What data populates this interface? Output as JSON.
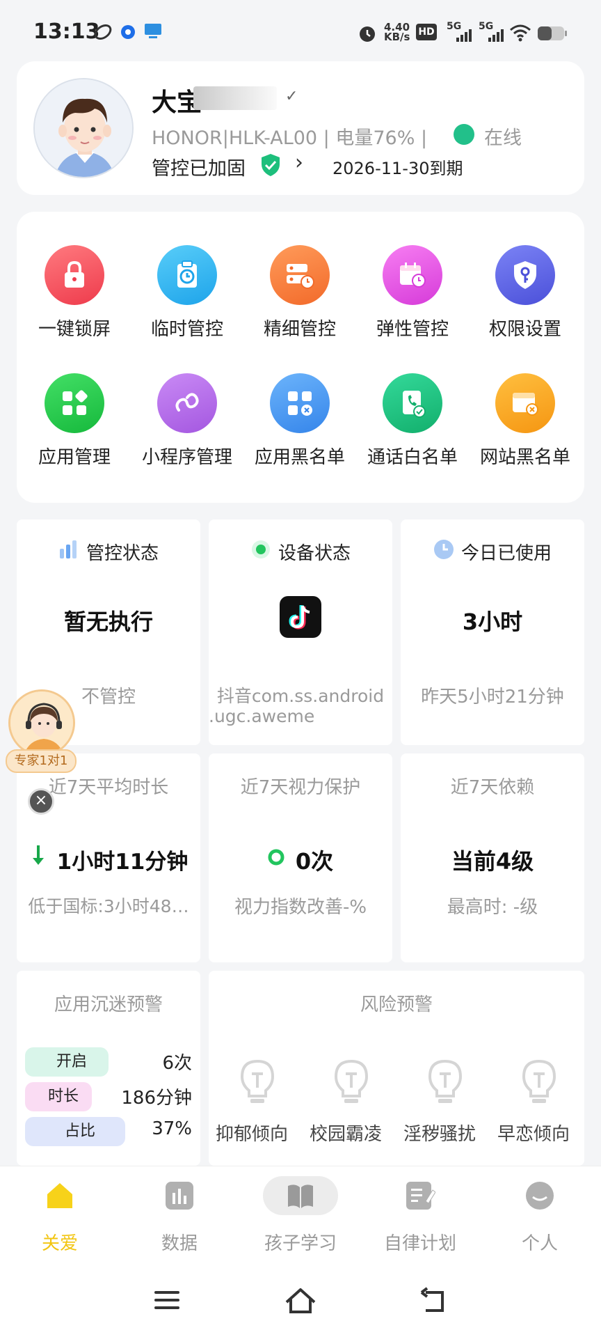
{
  "status_bar": {
    "time": "13:13",
    "net_speed_value": "4.40",
    "net_speed_unit": "KB/s",
    "hd_label": "HD",
    "signal1": "5G",
    "signal2": "5G"
  },
  "profile": {
    "name_visible": "大宝",
    "device_info": "HONOR|HLK-AL00 | 电量76% |",
    "online_status": "在线",
    "reinforce_status": "管控已加固",
    "expiry": "2026-11-30到期"
  },
  "features": [
    {
      "label": "一键锁屏",
      "icon": "lock-icon",
      "color": "#f4545e"
    },
    {
      "label": "临时管控",
      "icon": "clock-clipboard-icon",
      "color": "#2fb4f0"
    },
    {
      "label": "精细管控",
      "icon": "server-settings-icon",
      "color": "#f67a3a"
    },
    {
      "label": "弹性管控",
      "icon": "calendar-icon",
      "color": "#e24be3"
    },
    {
      "label": "权限设置",
      "icon": "key-shield-icon",
      "color": "#5a63e8"
    },
    {
      "label": "应用管理",
      "icon": "apps-icon",
      "color": "#1ec84a"
    },
    {
      "label": "小程序管理",
      "icon": "mini-program-icon",
      "color": "#b66be8"
    },
    {
      "label": "应用黑名单",
      "icon": "app-block-icon",
      "color": "#4a9af0"
    },
    {
      "label": "通话白名单",
      "icon": "phone-book-icon",
      "color": "#1dbf7c"
    },
    {
      "label": "网站黑名单",
      "icon": "web-block-icon",
      "color": "#f7a21f"
    }
  ],
  "stats": {
    "control_status": {
      "title": "管控状态",
      "value": "暂无执行",
      "sub": "不管控"
    },
    "device_status": {
      "title": "设备状态",
      "app_line1": "抖音com.ss.android",
      "app_line2": ".ugc.aweme"
    },
    "today_used": {
      "title": "今日已使用",
      "value": "3小时",
      "sub": "昨天5小时21分钟"
    },
    "avg_7d": {
      "title": "近7天平均时长",
      "value": "1小时11分钟",
      "sub": "低于国标:3小时48…"
    },
    "vision_7d": {
      "title": "近7天视力保护",
      "value": "0次",
      "sub": "视力指数改善-%"
    },
    "dependency_7d": {
      "title": "近7天依赖",
      "value": "当前4级",
      "sub": "最高时: -级"
    }
  },
  "addiction_warning": {
    "title": "应用沉迷预警",
    "rows": [
      {
        "label": "开启",
        "value": "6次",
        "color": "#d9f5ea"
      },
      {
        "label": "时长",
        "value": "186分钟",
        "color": "#fadcf3"
      },
      {
        "label": "占比",
        "value": "37%",
        "color": "#dfe6fb"
      }
    ]
  },
  "risk_warning": {
    "title": "风险预警",
    "items": [
      "抑郁倾向",
      "校园霸凌",
      "淫秽骚扰",
      "早恋倾向"
    ]
  },
  "floating": {
    "tag": "专家1对1"
  },
  "bottom_nav": [
    {
      "label": "关爱",
      "active": true
    },
    {
      "label": "数据",
      "active": false
    },
    {
      "label": "孩子学习",
      "active": false
    },
    {
      "label": "自律计划",
      "active": false
    },
    {
      "label": "个人",
      "active": false
    }
  ],
  "colors": {
    "accent_yellow": "#f2c511",
    "online_green": "#22c08a"
  }
}
